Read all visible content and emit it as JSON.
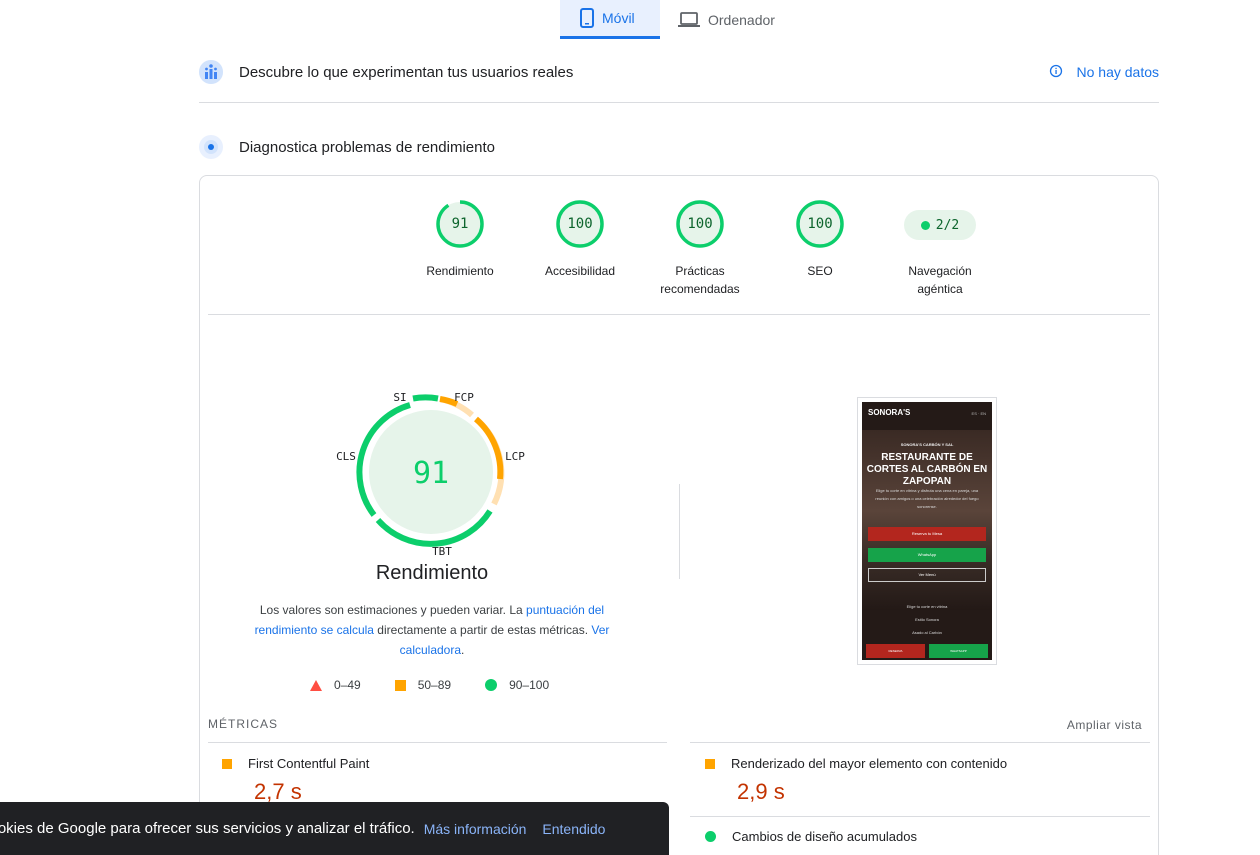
{
  "device_tabs": [
    {
      "label": "Móvil",
      "icon": "phone-icon",
      "active": true
    },
    {
      "label": "Ordenador",
      "icon": "laptop-icon",
      "active": false
    }
  ],
  "field_section": {
    "title": "Descubre lo que experimentan tus usuarios reales",
    "no_data": "No hay datos"
  },
  "lab_section": {
    "title": "Diagnostica problemas de rendimiento"
  },
  "categories": [
    {
      "score": "91",
      "label": "Rendimiento",
      "fraction": 0.91
    },
    {
      "score": "100",
      "label": "Accesibilidad",
      "fraction": 1.0
    },
    {
      "score": "100",
      "label": "Prácticas recomendadas",
      "fraction": 1.0
    },
    {
      "score": "100",
      "label": "SEO",
      "fraction": 1.0
    },
    {
      "score": "2/2",
      "label": "Navegación agéntica"
    }
  ],
  "performance": {
    "score": "91",
    "title": "Rendimiento",
    "segment_labels": {
      "si": "SI",
      "fcp": "FCP",
      "lcp": "LCP",
      "tbt": "TBT",
      "cls": "CLS"
    },
    "desc_1": "Los valores son estimaciones y pueden variar. La ",
    "desc_link_1": "puntuación del rendimiento se calcula",
    "desc_2": " directamente a partir de estas métricas. ",
    "desc_link_2": "Ver calculadora",
    "desc_3": ".",
    "legend": {
      "bad": "0–49",
      "avg": "50–89",
      "good": "90–100"
    },
    "colors": {
      "good": "#0cce6b",
      "average": "#ffa400",
      "poor": "#ff4e42"
    }
  },
  "thumbnail": {
    "logo": "SONORA'S",
    "lang": "ES · EN",
    "kicker": "SONORA'S CARBÓN Y SAL",
    "headline": "RESTAURANTE DE CORTES AL CARBÓN EN ZAPOPAN",
    "paragraph": "Elige tu corte en vitrina y disfruta una cena en pareja, una reunión con amigos o una celebración alrededor del fuego sonorense.",
    "btn_reserve": "Reserva tu Mesa",
    "btn_whatsapp": "WhatsApp",
    "btn_menu": "Ver Menú",
    "list": [
      "Elige tu corte en vitrina",
      "Estilo Sonora",
      "Asado al Carbón"
    ],
    "bottom_left": "RESERVA",
    "bottom_right": "WHATSAPP"
  },
  "metrics": {
    "heading": "MÉTRICAS",
    "expand": "Ampliar vista",
    "items": [
      {
        "name": "First Contentful Paint",
        "value": "2,7 s",
        "status": "average"
      },
      {
        "name": "Renderizado del mayor elemento con contenido",
        "value": "2,9 s",
        "status": "average"
      },
      {
        "name": "Cambios de diseño acumulados",
        "status": "good"
      }
    ]
  },
  "cookie_bar": {
    "text": "cookies de Google para ofrecer sus servicios y analizar el tráfico.",
    "more_info": "Más información",
    "ok": "Entendido"
  }
}
